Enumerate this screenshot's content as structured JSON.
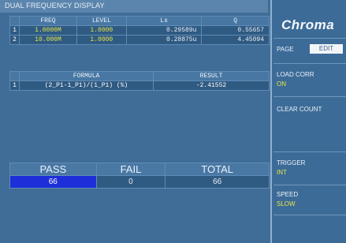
{
  "title": "DUAL FREQUENCY DISPLAY",
  "status": "• ● •",
  "freq_table": {
    "headers": [
      "FREQ",
      "LEVEL",
      "Ls",
      "Q"
    ],
    "rows": [
      {
        "idx": "1",
        "freq": "1.0000M",
        "level": "1.0000",
        "ls": "0.29589u",
        "q": "0.55657"
      },
      {
        "idx": "2",
        "freq": "10.000M",
        "level": "1.0000",
        "ls": "0.28875u",
        "q": "4.45094"
      }
    ]
  },
  "formula_table": {
    "headers": [
      "FORMULA",
      "RESULT"
    ],
    "rows": [
      {
        "idx": "1",
        "formula": "(2_P1-1_P1)/(1_P1) (%)",
        "result": "-2.41552"
      }
    ]
  },
  "counts": {
    "pass_label": "PASS",
    "fail_label": "FAIL",
    "total_label": "TOTAL",
    "pass_value": "66",
    "fail_value": "0",
    "total_value": "66"
  },
  "side_menu": {
    "logo": "Chroma",
    "page_label": "PAGE",
    "edit_label": "EDIT",
    "load_corr_label": "LOAD CORR",
    "load_corr_value": "ON",
    "clear_count_label": "CLEAR COUNT",
    "trigger_label": "TRIGGER",
    "trigger_value": "INT",
    "speed_label": "SPEED",
    "speed_value": "SLOW"
  },
  "colors": {
    "background": "#3f6d98",
    "highlight_yellow": "#e6e648",
    "pass_blue": "#1d2fd8"
  }
}
